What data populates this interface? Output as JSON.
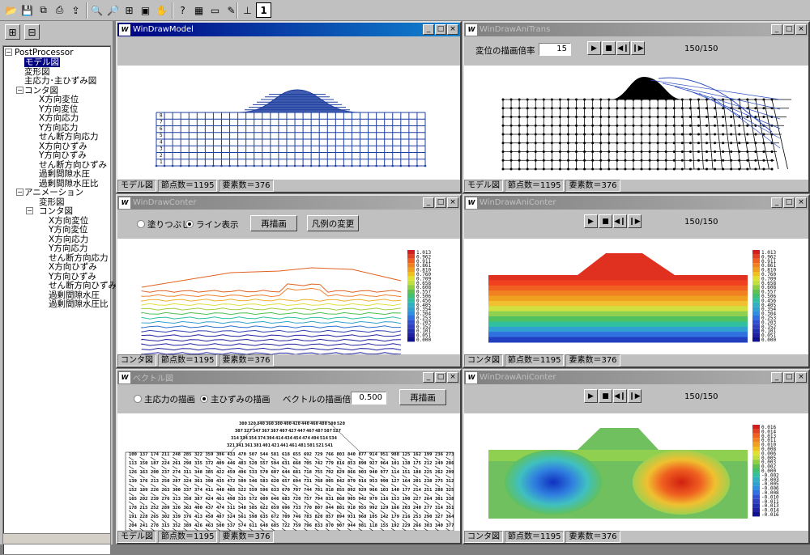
{
  "toolbar": {
    "icons": [
      "folder-open-icon",
      "save-icon",
      "copy-icon",
      "print-icon",
      "export-icon",
      "zoom-in-icon",
      "zoom-out-icon",
      "fit-icon",
      "window-icon",
      "hand-icon",
      "help-icon",
      "layout-icon",
      "card-icon",
      "pen-icon",
      "axis-icon",
      "info-icon"
    ]
  },
  "tree": {
    "root": "PostProcessor",
    "items": [
      {
        "label": "モデル図",
        "level": 1,
        "selected": true
      },
      {
        "label": "変形図",
        "level": 1
      },
      {
        "label": "主応力･主ひずみ図",
        "level": 1
      },
      {
        "label": "コンタ図",
        "level": 1,
        "expanded": true
      },
      {
        "label": "X方向変位",
        "level": 2
      },
      {
        "label": "Y方向変位",
        "level": 2
      },
      {
        "label": "X方向応力",
        "level": 2
      },
      {
        "label": "Y方向応力",
        "level": 2
      },
      {
        "label": "せん断方向応力",
        "level": 2
      },
      {
        "label": "X方向ひずみ",
        "level": 2
      },
      {
        "label": "Y方向ひずみ",
        "level": 2
      },
      {
        "label": "せん断方向ひずみ",
        "level": 2
      },
      {
        "label": "過剰間隙水圧",
        "level": 2
      },
      {
        "label": "過剰間隙水圧比",
        "level": 2
      },
      {
        "label": "アニメーション",
        "level": 1,
        "expanded": true
      },
      {
        "label": "変形図",
        "level": 2
      },
      {
        "label": "コンタ図",
        "level": 2,
        "expanded": true
      },
      {
        "label": "X方向変位",
        "level": 3
      },
      {
        "label": "Y方向変位",
        "level": 3
      },
      {
        "label": "X方向応力",
        "level": 3
      },
      {
        "label": "Y方向応力",
        "level": 3
      },
      {
        "label": "せん断方向応力",
        "level": 3
      },
      {
        "label": "X方向ひずみ",
        "level": 3
      },
      {
        "label": "Y方向ひずみ",
        "level": 3
      },
      {
        "label": "せん断方向ひずみ",
        "level": 3
      },
      {
        "label": "過剰間隙水圧",
        "level": 3
      },
      {
        "label": "過剰間隙水圧比",
        "level": 3
      }
    ]
  },
  "windows": {
    "model": {
      "title": "WinDrawModel",
      "status": [
        "モデル図",
        "節点数＝1195",
        "要素数＝376"
      ],
      "row_labels": [
        "1",
        "2",
        "3",
        "4",
        "5",
        "6",
        "7",
        "8"
      ]
    },
    "anitrans": {
      "title": "WinDrawAniTrans",
      "scale_label": "変位の描画倍率",
      "scale_value": "15",
      "frames": "150/150",
      "status": [
        "モデル図",
        "節点数＝1195",
        "要素数＝376"
      ]
    },
    "conter": {
      "title": "WinDrawConter",
      "radio1": "塗りつぶし",
      "radio2": "ライン表示",
      "redraw": "再描画",
      "legend_btn": "凡例の変更",
      "status": [
        "コンタ図",
        "節点数＝1195",
        "要素数＝376"
      ],
      "legend": [
        "1.013",
        "0.962",
        "0.911",
        "0.861",
        "0.810",
        "0.760",
        "0.709",
        "0.658",
        "0.608",
        "0.557",
        "0.506",
        "0.456",
        "0.405",
        "0.354",
        "0.304",
        "0.253",
        "0.203",
        "0.152",
        "0.101",
        "0.051",
        "0.000"
      ]
    },
    "aniconter1": {
      "title": "WinDrawAniConter",
      "frames": "150/150",
      "status": [
        "コンタ図",
        "節点数＝1195",
        "要素数＝376"
      ],
      "legend": [
        "1.013",
        "0.962",
        "0.911",
        "0.861",
        "0.810",
        "0.760",
        "0.709",
        "0.658",
        "0.608",
        "0.557",
        "0.506",
        "0.456",
        "0.405",
        "0.354",
        "0.304",
        "0.253",
        "0.203",
        "0.152",
        "0.101",
        "0.051",
        "0.000"
      ]
    },
    "vector": {
      "title": "ベクトル図",
      "radio1": "主応力の描画",
      "radio2": "主ひずみの描画",
      "scale_label": "ベクトルの描画倍率",
      "scale_value": "0.500",
      "redraw": "再描画",
      "status": [
        "モデル図",
        "節点数＝1195",
        "要素数＝376"
      ]
    },
    "aniconter2": {
      "title": "WinDrawAniConter",
      "frames": "150/150",
      "status": [
        "コンタ図",
        "節点数＝1195",
        "要素数＝376"
      ],
      "legend": [
        "0.016",
        "0.014",
        "0.013",
        "0.011",
        "0.010",
        "0.008",
        "0.006",
        "0.005",
        "0.003",
        "0.002",
        "0.000",
        "-0.002",
        "-0.003",
        "-0.005",
        "-0.006",
        "-0.008",
        "-0.010",
        "-0.011",
        "-0.013",
        "-0.014",
        "-0.016"
      ]
    }
  },
  "colors": {
    "title_active": "#000080",
    "title_inactive": "#808080",
    "mesh": "#1f3fa0"
  }
}
